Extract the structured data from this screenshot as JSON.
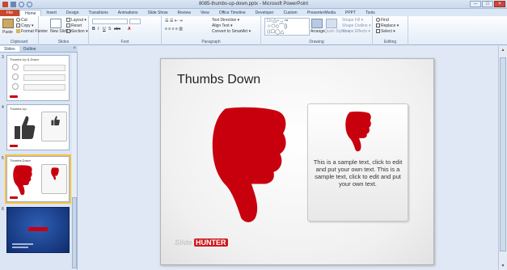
{
  "window": {
    "title": "8085-thumbs-up-down.pptx - Microsoft PowerPoint"
  },
  "tabs": [
    "File",
    "Home",
    "Insert",
    "Design",
    "Transitions",
    "Animations",
    "Slide Show",
    "Review",
    "View",
    "Office Timeline",
    "Developer",
    "Custom",
    "PresenterMedia",
    "PPPT",
    "Tools"
  ],
  "ribbon": {
    "clipboard": {
      "label": "Clipboard",
      "cut": "Cut",
      "copy": "Copy ▾",
      "format_painter": "Format Painter",
      "paste": "Paste"
    },
    "slides": {
      "label": "Slides",
      "new_slide": "New Slide ▾",
      "layout": "Layout ▾",
      "reset": "Reset",
      "section": "Section ▾"
    },
    "font": {
      "label": "Font"
    },
    "paragraph": {
      "label": "Paragraph",
      "text_direction": "Text Direction ▾",
      "align_text": "Align Text ▾",
      "convert_smartart": "Convert to SmartArt ▾"
    },
    "drawing": {
      "label": "Drawing",
      "arrange": "Arrange",
      "quick_styles": "Quick Styles ▾",
      "shape_fill": "Shape Fill ▾",
      "shape_outline": "Shape Outline ▾",
      "shape_effects": "Shape Effects ▾"
    },
    "editing": {
      "label": "Editing",
      "find": "Find",
      "replace": "Replace ▾",
      "select": "Select ▾"
    }
  },
  "panel": {
    "tabs": [
      "Slides",
      "Outline"
    ],
    "close": "×",
    "thumbnails": [
      {
        "num": "3",
        "title": "Thumbs Up & Down"
      },
      {
        "num": "4",
        "title": "Thumbs Up"
      },
      {
        "num": "5",
        "title": "Thumbs Down",
        "selected": true
      },
      {
        "num": "6",
        "title": ""
      }
    ]
  },
  "slide": {
    "title": "Thumbs Down",
    "body": "This is a sample text, click to edit and put your own text. This is a sample text, click to edit and put your own text.",
    "logo_left": "Slide",
    "logo_right": "HUNTER"
  },
  "colors": {
    "accent_red": "#c8000e",
    "file_tab": "#c8472f"
  }
}
